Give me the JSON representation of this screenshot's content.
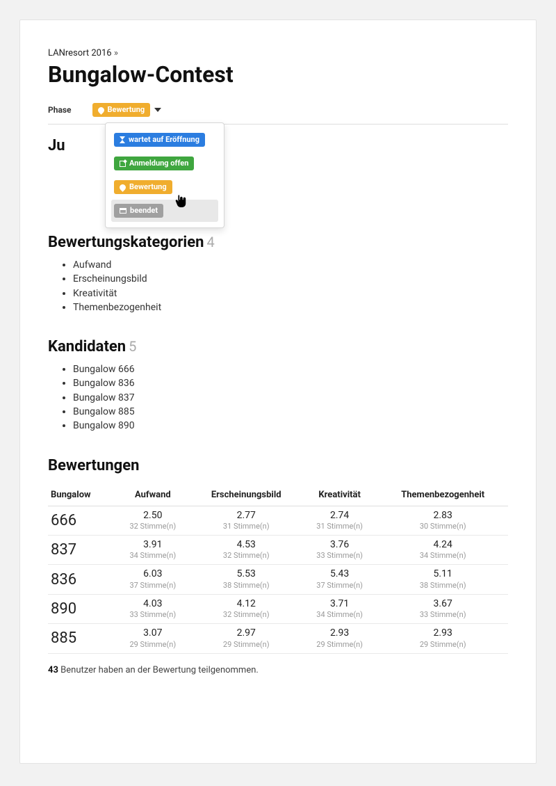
{
  "breadcrumb": {
    "parent": "LANresort 2016",
    "sep": "»"
  },
  "title": "Bungalow-Contest",
  "phase": {
    "label": "Phase",
    "current": "Bewertung",
    "options": [
      {
        "label": "wartet auf Eröffnung",
        "style": "blue",
        "icon": "hourglass"
      },
      {
        "label": "Anmeldung offen",
        "style": "green",
        "icon": "edit"
      },
      {
        "label": "Bewertung",
        "style": "orange",
        "icon": "comment"
      },
      {
        "label": "beendet",
        "style": "gray",
        "icon": "archive",
        "hovered": true
      }
    ]
  },
  "sections": {
    "categories": {
      "title": "Bewertungskategorien",
      "count": "4",
      "items": [
        "Aufwand",
        "Erscheinungsbild",
        "Kreativität",
        "Themenbezogenheit"
      ]
    },
    "candidates": {
      "title": "Kandidaten",
      "count": "5",
      "items": [
        "Bungalow 666",
        "Bungalow 836",
        "Bungalow 837",
        "Bungalow 885",
        "Bungalow 890"
      ]
    },
    "ratings": {
      "title": "Bewertungen",
      "columns": [
        "Bungalow",
        "Aufwand",
        "Erscheinungsbild",
        "Kreativität",
        "Themenbezogenheit"
      ],
      "vote_word": "Stimme(n)",
      "rows": [
        {
          "id": "666",
          "cells": [
            {
              "v": "2.50",
              "n": "32"
            },
            {
              "v": "2.77",
              "n": "31"
            },
            {
              "v": "2.74",
              "n": "31"
            },
            {
              "v": "2.83",
              "n": "30"
            }
          ]
        },
        {
          "id": "837",
          "cells": [
            {
              "v": "3.91",
              "n": "34"
            },
            {
              "v": "4.53",
              "n": "32"
            },
            {
              "v": "3.76",
              "n": "33"
            },
            {
              "v": "4.24",
              "n": "34"
            }
          ]
        },
        {
          "id": "836",
          "cells": [
            {
              "v": "6.03",
              "n": "37"
            },
            {
              "v": "5.53",
              "n": "38"
            },
            {
              "v": "5.43",
              "n": "37"
            },
            {
              "v": "5.11",
              "n": "38"
            }
          ]
        },
        {
          "id": "890",
          "cells": [
            {
              "v": "4.03",
              "n": "33"
            },
            {
              "v": "4.12",
              "n": "32"
            },
            {
              "v": "3.71",
              "n": "34"
            },
            {
              "v": "3.67",
              "n": "33"
            }
          ]
        },
        {
          "id": "885",
          "cells": [
            {
              "v": "3.07",
              "n": "29"
            },
            {
              "v": "2.97",
              "n": "29"
            },
            {
              "v": "2.93",
              "n": "29"
            },
            {
              "v": "2.93",
              "n": "29"
            }
          ]
        }
      ]
    }
  },
  "footnote": {
    "count": "43",
    "text": "Benutzer haben an der Bewertung teilgenommen."
  },
  "hidden_behind_dropdown_heading_fragment": "Ju"
}
